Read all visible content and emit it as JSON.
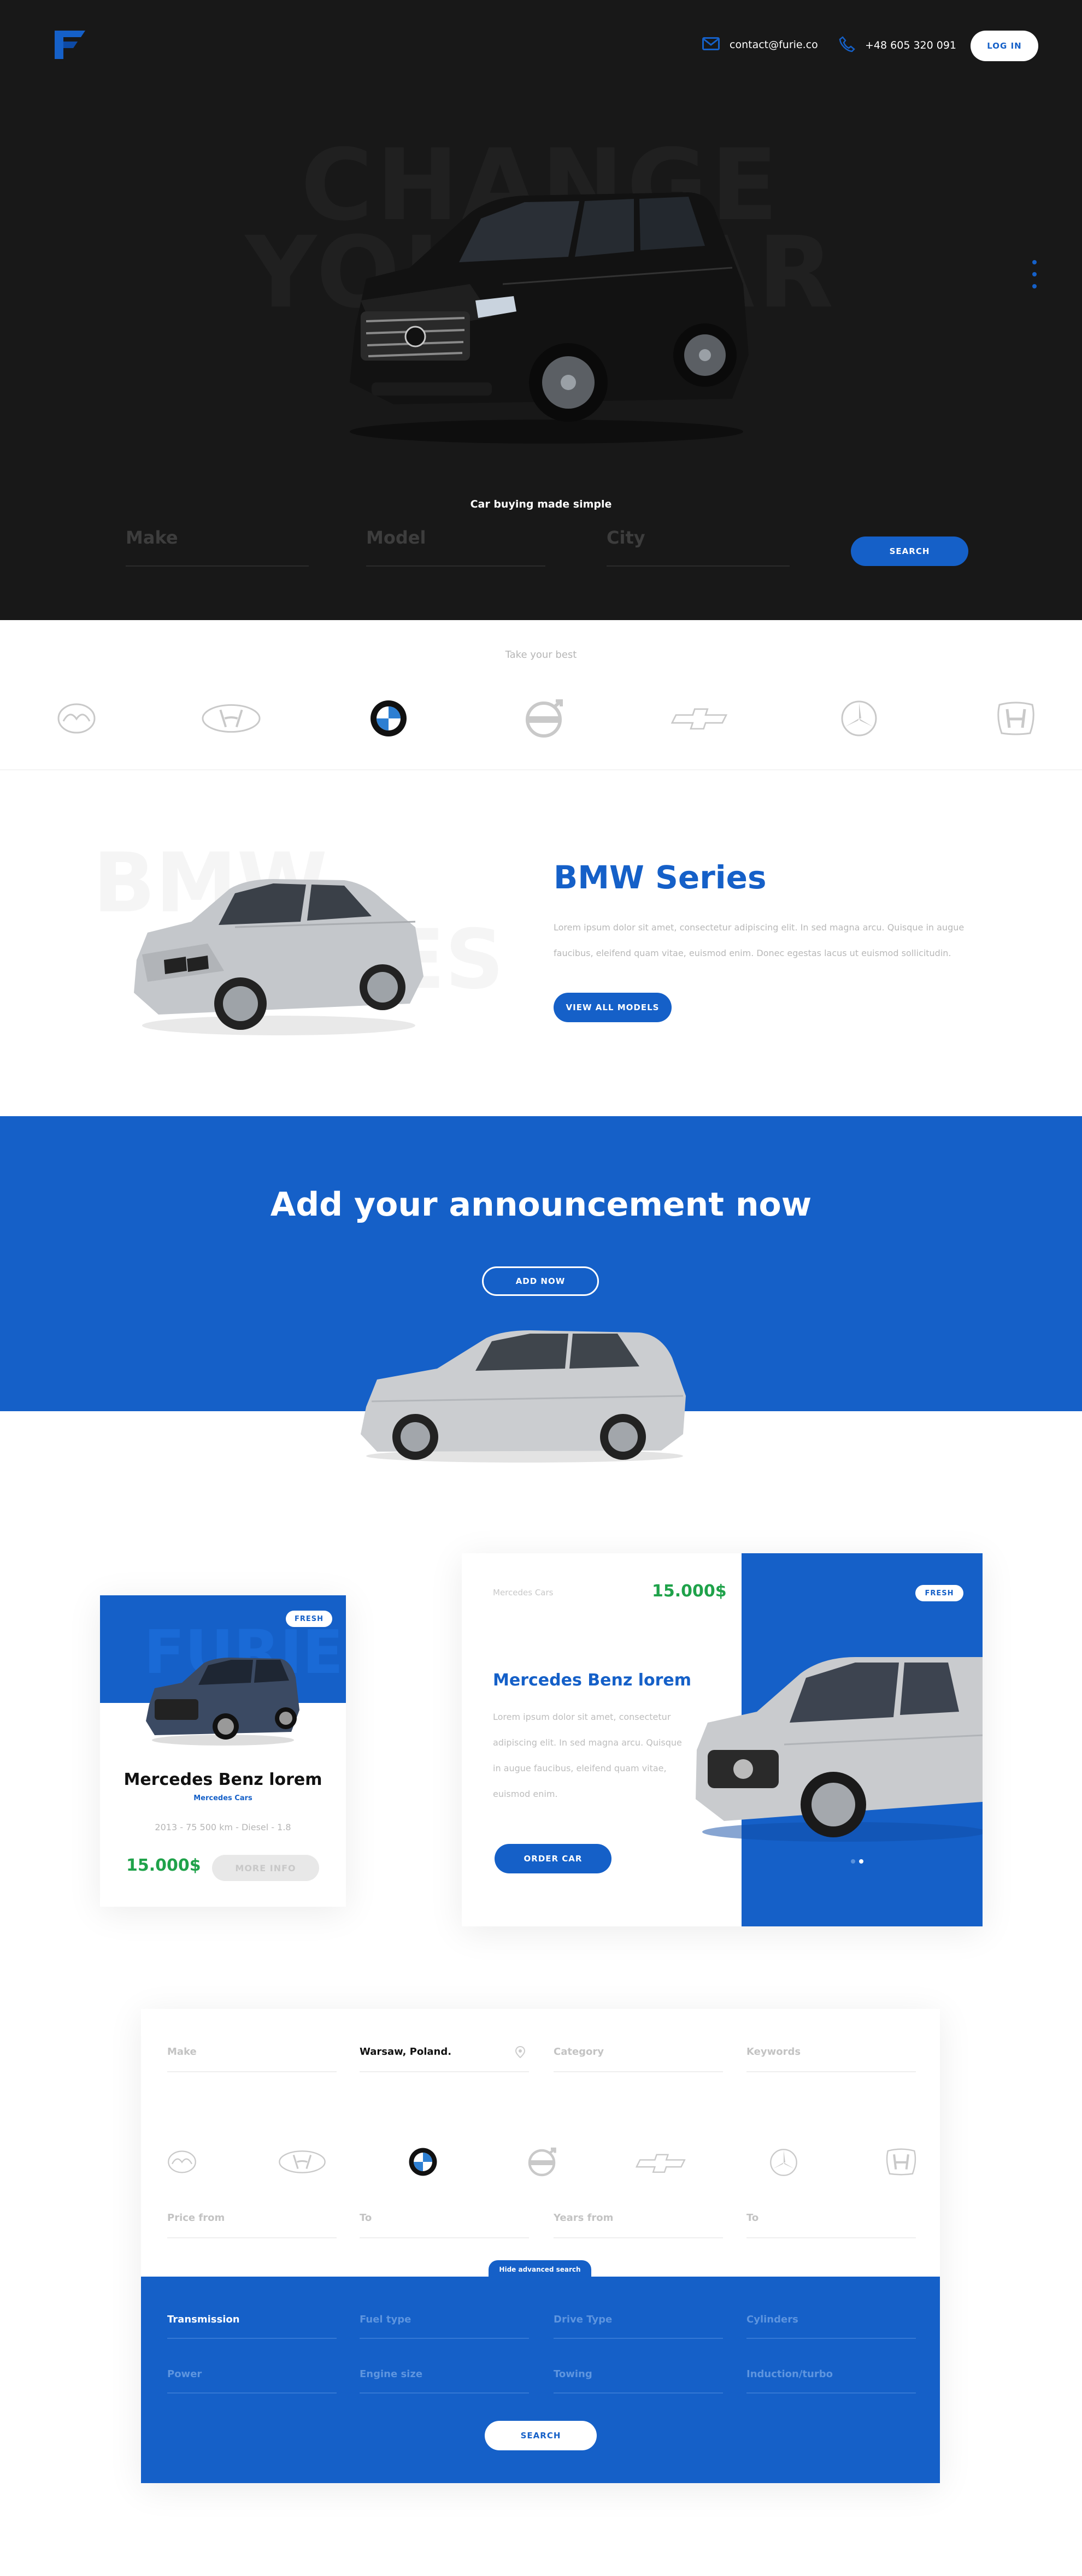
{
  "colors": {
    "accent": "#1560c8",
    "price": "#1fa24a",
    "dark": "#181818"
  },
  "header": {
    "email": "contact@furie.co",
    "phone": "+48 605 320 091",
    "login_label": "LOG IN",
    "logo": "furie-logo"
  },
  "hero": {
    "bg_line1": "CHANGE",
    "bg_line2": "YOUR CAR",
    "tagline": "Car buying made simple",
    "make_placeholder": "Make",
    "model_placeholder": "Model",
    "city_placeholder": "City",
    "search_label": "SEARCH"
  },
  "brands": {
    "title": "Take your best",
    "items": [
      "mazda",
      "hyundai",
      "bmw",
      "volvo",
      "chevrolet",
      "mercedes",
      "honda"
    ]
  },
  "series": {
    "bg_text1": "BMW",
    "bg_text2": "SERIES",
    "title": "BMW Series",
    "line1": "Lorem ipsum dolor sit amet, consectetur adipiscing elit. In sed magna arcu. Quisque in augue",
    "line2": "faucibus, eleifend quam vitae, euismod enim. Donec egestas lacus ut euismod sollicitudin.",
    "button": "VIEW ALL MODELS"
  },
  "announce": {
    "title": "Add your announcement now",
    "button": "ADD NOW"
  },
  "card_small": {
    "badge": "FRESH",
    "bg_text": "FURIE",
    "title": "Mercedes Benz lorem",
    "subtitle": "Mercedes Cars",
    "meta": "2013 - 75 500 km - Diesel - 1.8",
    "price": "15.000$",
    "button": "MORE INFO"
  },
  "card_large": {
    "brand": "Mercedes Cars",
    "price": "15.000$",
    "title": "Mercedes Benz lorem",
    "line1": "Lorem ipsum dolor sit amet, consectetur",
    "line2": "adipiscing elit. In sed magna arcu. Quisque",
    "line3": "in augue faucibus, eleifend quam vitae,",
    "line4": "euismod enim.",
    "button": "ORDER CAR",
    "badge": "FRESH"
  },
  "search_panel": {
    "make": "Make",
    "location": "Warsaw, Poland.",
    "category": "Category",
    "keywords": "Keywords",
    "price_from": "Price from",
    "price_to": "To",
    "years_from": "Years from",
    "years_to": "To",
    "toggle": "Hide advanced search",
    "transmission": "Transmission",
    "fuel": "Fuel type",
    "drive": "Drive Type",
    "cylinders": "Cylinders",
    "power": "Power",
    "engine": "Engine size",
    "towing": "Towing",
    "induction": "Induction/turbo",
    "search": "SEARCH"
  }
}
